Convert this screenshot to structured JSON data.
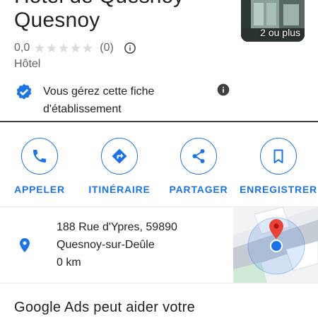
{
  "header": {
    "title_fragment": "Hôtel de Quesnoy",
    "title": "Quesnoy",
    "photos_label": "2 ou plus"
  },
  "rating": {
    "value": "0,0",
    "stars_filled": 0,
    "stars_total": 5,
    "count": "(0)"
  },
  "category": "Hôtel",
  "verified": {
    "line1": "Vous gérez cette fiche",
    "line2": "d'établissement"
  },
  "actions": [
    {
      "label": "APPELER",
      "icon": "phone-icon"
    },
    {
      "label": "ITINÉRAIRE",
      "icon": "directions-icon"
    },
    {
      "label": "PARTAGER",
      "icon": "share-icon"
    },
    {
      "label": "ENREGISTRER",
      "icon": "bookmark-icon"
    }
  ],
  "address": {
    "line1": "188 Rue d'Ypres, 59890",
    "line2": "Quesnoy-sur-Deûle",
    "distance": "0 km"
  },
  "ads": {
    "title": "Google Ads peut aider votre"
  },
  "colors": {
    "accent": "#1a73e8",
    "text": "#202124",
    "secondary": "#5f6368",
    "star_empty": "#dadce0",
    "map_pin": "#ea4335"
  }
}
